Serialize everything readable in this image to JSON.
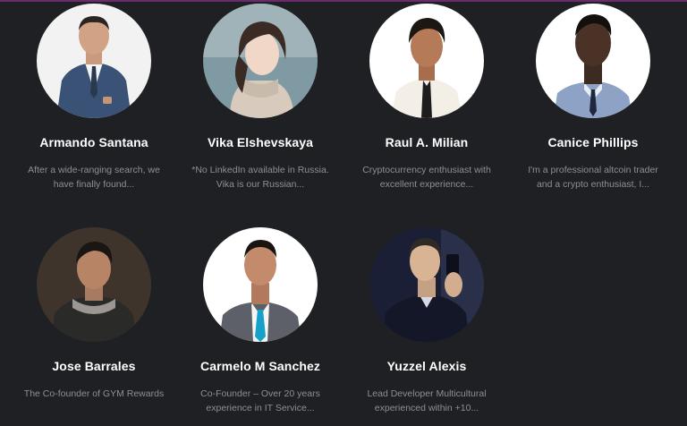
{
  "team": [
    {
      "name": "Armando Santana",
      "bio_line1": "After a wide-ranging search, we",
      "bio_line2": "have finally found..."
    },
    {
      "name": "Vika Elshevskaya",
      "bio_line1": "*No LinkedIn available in Russia.",
      "bio_line2": "Vika is our Russian..."
    },
    {
      "name": "Raul A. Milian",
      "bio_line1": "Cryptocurrency enthusiast with",
      "bio_line2": "excellent experience..."
    },
    {
      "name": "Canice Phillips",
      "bio_line1": "I'm a professional altcoin trader",
      "bio_line2": "and a crypto enthusiast, I..."
    },
    {
      "name": "Jose Barrales",
      "bio_line1": "The Co-founder of GYM Rewards",
      "bio_line2": ""
    },
    {
      "name": "Carmelo M Sanchez",
      "bio_line1": "Co-Founder – Over 20 years",
      "bio_line2": "experience in IT Service..."
    },
    {
      "name": "Yuzzel Alexis",
      "bio_line1": "Lead Developer Multicultural",
      "bio_line2": "experienced within +10..."
    }
  ],
  "colors": {
    "background": "#1f2023",
    "name_text": "#ffffff",
    "bio_text": "#8d8f93",
    "top_accent": "#6b2a6e"
  }
}
